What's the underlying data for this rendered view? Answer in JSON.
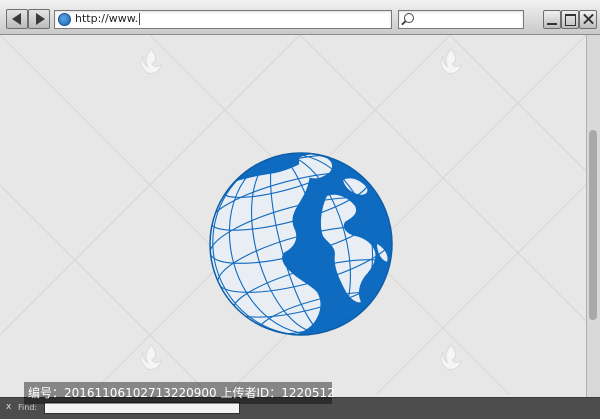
{
  "toolbar": {
    "back_icon": "triangle-left",
    "forward_icon": "triangle-right",
    "address_value": "http://www.",
    "search_value": ""
  },
  "window_controls": {
    "minimize_icon": "minimize",
    "maximize_icon": "maximize",
    "close_icon": "close"
  },
  "content": {
    "main_image": "globe-icon",
    "globe_colors": {
      "ocean": "#0f6bbf",
      "land": "#e9eef5",
      "grid": "#0f6bbf"
    },
    "watermark_icon": "leaf-logo"
  },
  "find_bar": {
    "close_label": "x",
    "find_label": "Find:",
    "find_value": ""
  },
  "overlay": {
    "text": "编号：20161106102713220900 上传者ID：1220512"
  }
}
